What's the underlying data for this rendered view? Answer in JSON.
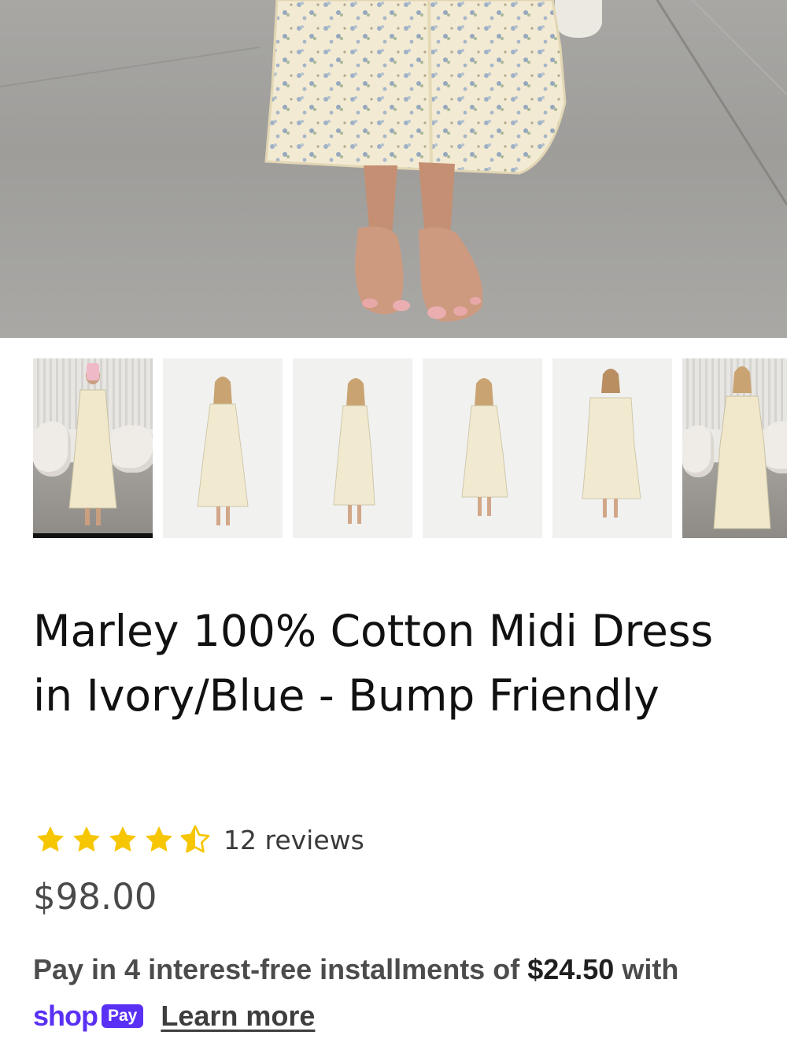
{
  "product": {
    "title": "Marley 100% Cotton Midi Dress in Ivory/Blue - Bump Friendly",
    "rating": {
      "value": 4.5,
      "max": 5,
      "reviews_label": "12 reviews"
    },
    "price": "$98.00"
  },
  "installments": {
    "text_before": "Pay in 4 interest-free installments of",
    "amount": "$24.50",
    "text_after": "with",
    "shop_word": "shop",
    "pay_badge": "Pay",
    "learn_more": "Learn more"
  },
  "gallery": {
    "active_index": 0,
    "thumbnails": [
      {
        "scene": "room"
      },
      {
        "scene": "studio"
      },
      {
        "scene": "studio"
      },
      {
        "scene": "studio"
      },
      {
        "scene": "studio"
      },
      {
        "scene": "room"
      }
    ]
  },
  "colors": {
    "star": "#f6c600",
    "shop_pay_purple": "#5a31f4",
    "active_indicator": "#111111"
  }
}
